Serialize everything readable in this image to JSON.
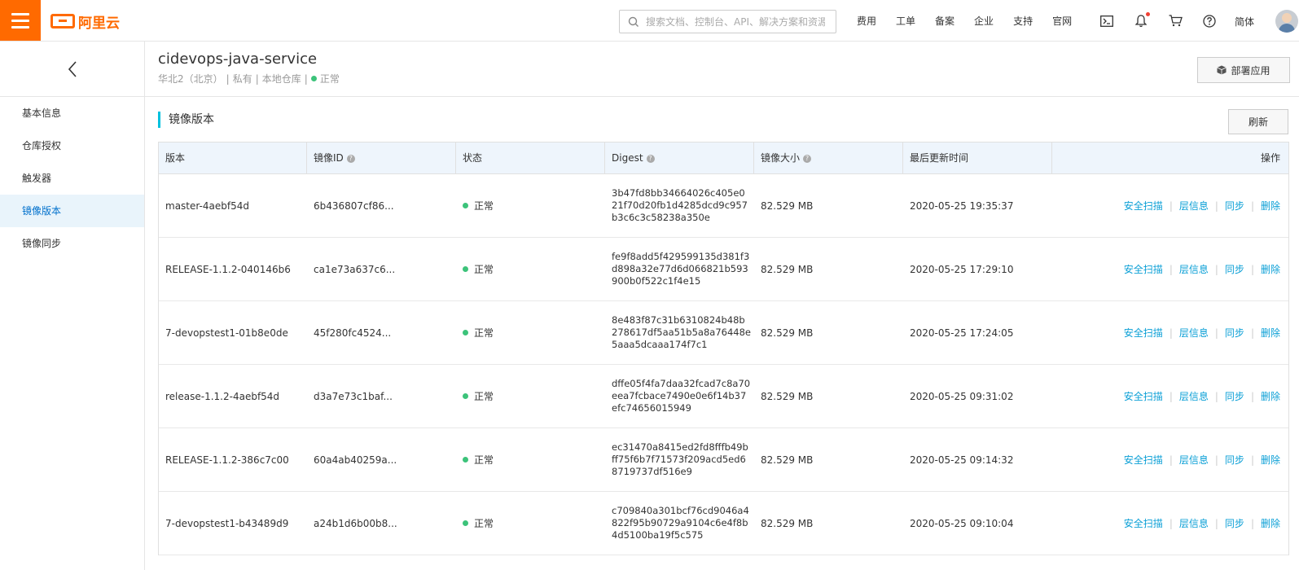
{
  "brand": {
    "name": "阿里云"
  },
  "search": {
    "placeholder": "搜索文档、控制台、API、解决方案和资源"
  },
  "topnav": [
    "费用",
    "工单",
    "备案",
    "企业",
    "支持",
    "官网"
  ],
  "lang": "简体",
  "repo": {
    "name": "cidevops-java-service",
    "region": "华北2（北京）",
    "visibility": "私有",
    "source": "本地仓库",
    "status": "正常"
  },
  "deploy_label": "部署应用",
  "sidebar": {
    "items": [
      {
        "label": "基本信息",
        "active": false
      },
      {
        "label": "仓库授权",
        "active": false
      },
      {
        "label": "触发器",
        "active": false
      },
      {
        "label": "镜像版本",
        "active": true
      },
      {
        "label": "镜像同步",
        "active": false
      }
    ]
  },
  "section": {
    "title": "镜像版本",
    "refresh_label": "刷新"
  },
  "table": {
    "columns": [
      "版本",
      "镜像ID",
      "状态",
      "Digest",
      "镜像大小",
      "最后更新时间",
      "操作"
    ],
    "actions": [
      "安全扫描",
      "层信息",
      "同步",
      "删除"
    ],
    "rows": [
      {
        "version": "master-4aebf54d",
        "image_id": "6b436807cf86...",
        "status": "正常",
        "digest": "3b47fd8bb34664026c405e021f70d20fb1d4285dcd9c957b3c6c3c58238a350e",
        "size": "82.529 MB",
        "updated": "2020-05-25 19:35:37"
      },
      {
        "version": "RELEASE-1.1.2-040146b6",
        "image_id": "ca1e73a637c6...",
        "status": "正常",
        "digest": "fe9f8add5f429599135d381f3d898a32e77d6d066821b593900b0f522c1f4e15",
        "size": "82.529 MB",
        "updated": "2020-05-25 17:29:10"
      },
      {
        "version": "7-devopstest1-01b8e0de",
        "image_id": "45f280fc4524...",
        "status": "正常",
        "digest": "8e483f87c31b6310824b48b278617df5aa51b5a8a76448e5aaa5dcaaa174f7c1",
        "size": "82.529 MB",
        "updated": "2020-05-25 17:24:05"
      },
      {
        "version": "release-1.1.2-4aebf54d",
        "image_id": "d3a7e73c1baf...",
        "status": "正常",
        "digest": "dffe05f4fa7daa32fcad7c8a70eea7fcbace7490e0e6f14b37efc74656015949",
        "size": "82.529 MB",
        "updated": "2020-05-25 09:31:02"
      },
      {
        "version": "RELEASE-1.1.2-386c7c00",
        "image_id": "60a4ab40259a...",
        "status": "正常",
        "digest": "ec31470a8415ed2fd8fffb49bff75f6b7f71573f209acd5ed68719737df516e9",
        "size": "82.529 MB",
        "updated": "2020-05-25 09:14:32"
      },
      {
        "version": "7-devopstest1-b43489d9",
        "image_id": "a24b1d6b00b8...",
        "status": "正常",
        "digest": "c709840a301bcf76cd9046a4822f95b90729a9104c6e4f8b4d5100ba19f5c575",
        "size": "82.529 MB",
        "updated": "2020-05-25 09:10:04"
      }
    ]
  },
  "colors": {
    "brand": "#ff6a00",
    "link": "#0a9fd6",
    "accent": "#00c1de",
    "status_ok": "#3cc37a"
  }
}
